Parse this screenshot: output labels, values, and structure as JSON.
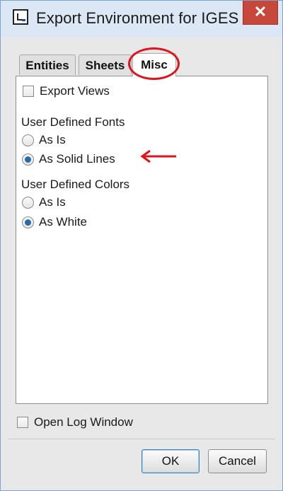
{
  "window": {
    "title": "Export Environment for IGES",
    "close_label": "✕"
  },
  "tabs": [
    {
      "label": "Entities",
      "active": false
    },
    {
      "label": "Sheets",
      "active": false
    },
    {
      "label": "Misc",
      "active": true
    }
  ],
  "misc": {
    "export_views": {
      "label": "Export Views",
      "checked": false
    },
    "fonts": {
      "group_label": "User Defined Fonts",
      "options": [
        {
          "label": "As Is",
          "selected": false
        },
        {
          "label": "As Solid Lines",
          "selected": true
        }
      ]
    },
    "colors": {
      "group_label": "User Defined Colors",
      "options": [
        {
          "label": "As Is",
          "selected": false
        },
        {
          "label": "As White",
          "selected": true
        }
      ]
    }
  },
  "footer": {
    "open_log": {
      "label": "Open Log Window",
      "checked": false
    },
    "ok_label": "OK",
    "cancel_label": "Cancel"
  },
  "annotation_color": "#e0121a"
}
